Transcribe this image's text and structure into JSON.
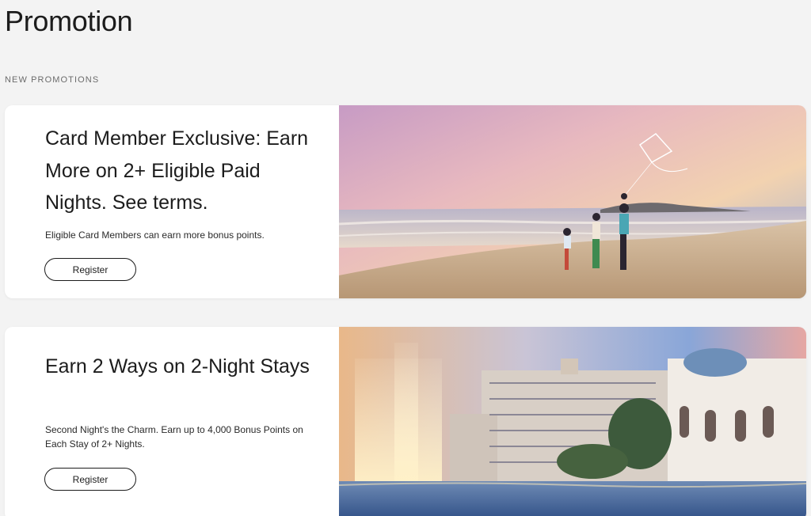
{
  "page": {
    "title": "Promotion",
    "section_label": "NEW PROMOTIONS"
  },
  "promotions": [
    {
      "title": "Card Member Exclusive: Earn More on 2+ Eligible Paid Nights. See terms.",
      "description": "Eligible Card Members can earn more bonus points.",
      "button_label": "Register",
      "image": "family-on-beach-with-kite-image"
    },
    {
      "title": "Earn 2 Ways on 2-Night Stays",
      "description": "Second Night's the Charm. Earn up to 4,000 Bonus Points on Each Stay of 2+ Nights.",
      "button_label": "Register",
      "image": "resort-hotel-with-fountains-image"
    }
  ],
  "colors": {
    "background": "#f3f3f3",
    "card": "#ffffff",
    "text": "#1c1c1c"
  }
}
